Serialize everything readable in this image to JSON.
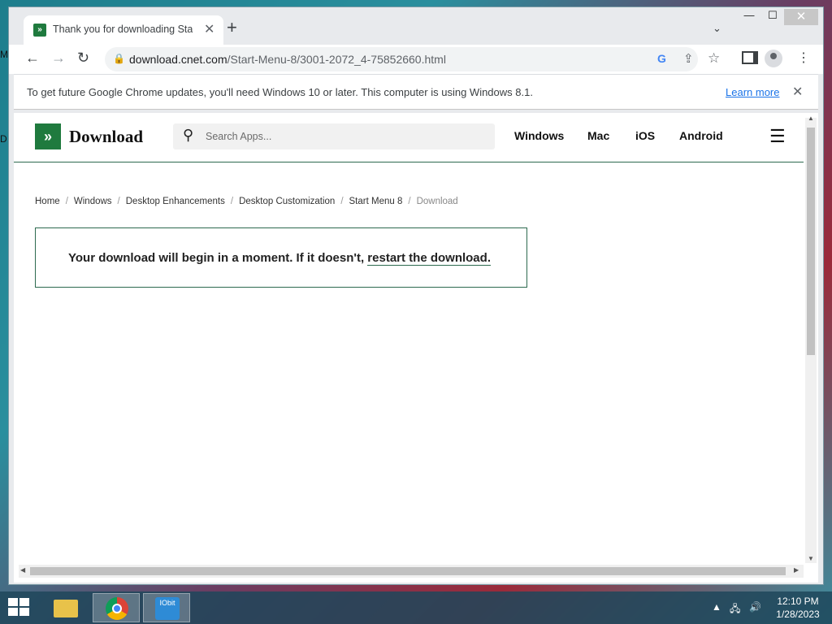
{
  "desktop": {
    "edge_labels": [
      "M",
      "D"
    ]
  },
  "browser": {
    "tab": {
      "title": "Thank you for downloading Start",
      "close_glyph": "✕"
    },
    "new_tab_glyph": "+",
    "tab_search_glyph": "⌄",
    "window_controls": {
      "minimize": "—",
      "maximize": "☐",
      "close": "✕"
    },
    "nav": {
      "back": "←",
      "forward": "→",
      "reload": "↻"
    },
    "address": {
      "lock_glyph": "🔒",
      "host": "download.cnet.com",
      "path": "/Start-Menu-8/3001-2072_4-75852660.html"
    },
    "toolbar_icons": {
      "google": "G",
      "share": "⇪",
      "star": "☆",
      "menu": "⋮"
    },
    "infobar": {
      "message": "To get future Google Chrome updates, you'll need Windows 10 or later. This computer is using Windows 8.1.",
      "learn_more": "Learn more",
      "close_glyph": "✕"
    }
  },
  "site": {
    "logo_mark": "»",
    "logo_text": "Download",
    "search_placeholder": "Search Apps...",
    "nav": [
      "Windows",
      "Mac",
      "iOS",
      "Android"
    ],
    "hamburger": "☰",
    "breadcrumb": [
      "Home",
      "Windows",
      "Desktop Enhancements",
      "Desktop Customization",
      "Start Menu 8",
      "Download"
    ],
    "notice": {
      "text": "Your download will begin in a moment. If it doesn't, ",
      "link": "restart the download."
    }
  },
  "taskbar": {
    "apps": [
      "file-explorer",
      "chrome",
      "iobit"
    ],
    "iobit_label": "IObit",
    "tray": {
      "arrow": "▲",
      "network": "🖧",
      "volume": "🔊"
    },
    "clock": {
      "time": "12:10 PM",
      "date": "1/28/2023"
    }
  },
  "colors": {
    "brand_green": "#1f7a3e",
    "link_blue": "#1a73e8"
  }
}
